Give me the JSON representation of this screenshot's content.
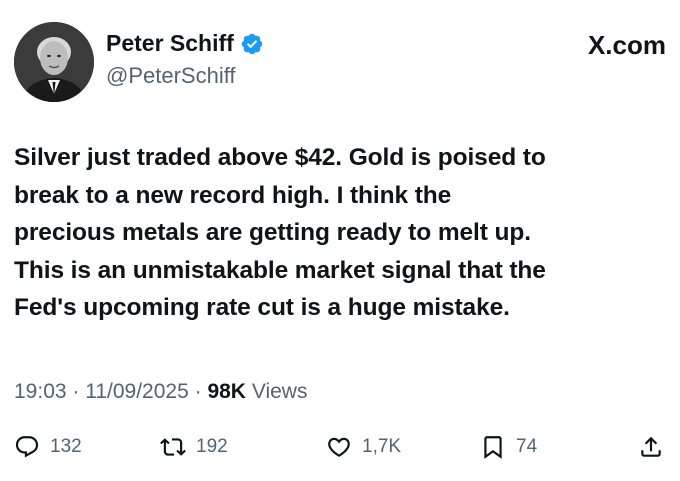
{
  "author": {
    "name": "Peter Schiff",
    "handle": "@PeterSchiff",
    "verified": true,
    "avatar_icon": "profile-photo"
  },
  "site": {
    "label": "X.com",
    "icon": "x-logo-icon"
  },
  "tweet": {
    "lines": [
      "Silver just traded above $42. Gold is poised to",
      "break to a new record high. I think the",
      "precious metals are getting ready to melt up.",
      "This is an unmistakable market signal that the",
      "Fed's upcoming rate cut is a huge mistake."
    ]
  },
  "meta": {
    "time": "19:03",
    "separator": " · ",
    "date": "11/09/2025",
    "views_count": "98K",
    "views_label": "Views"
  },
  "actions": {
    "replies": "132",
    "reposts": "192",
    "likes": "1,7K",
    "bookmarks": "74"
  },
  "colors": {
    "text": "#0f1419",
    "muted": "#536471",
    "verified": "#1d9bf0"
  }
}
